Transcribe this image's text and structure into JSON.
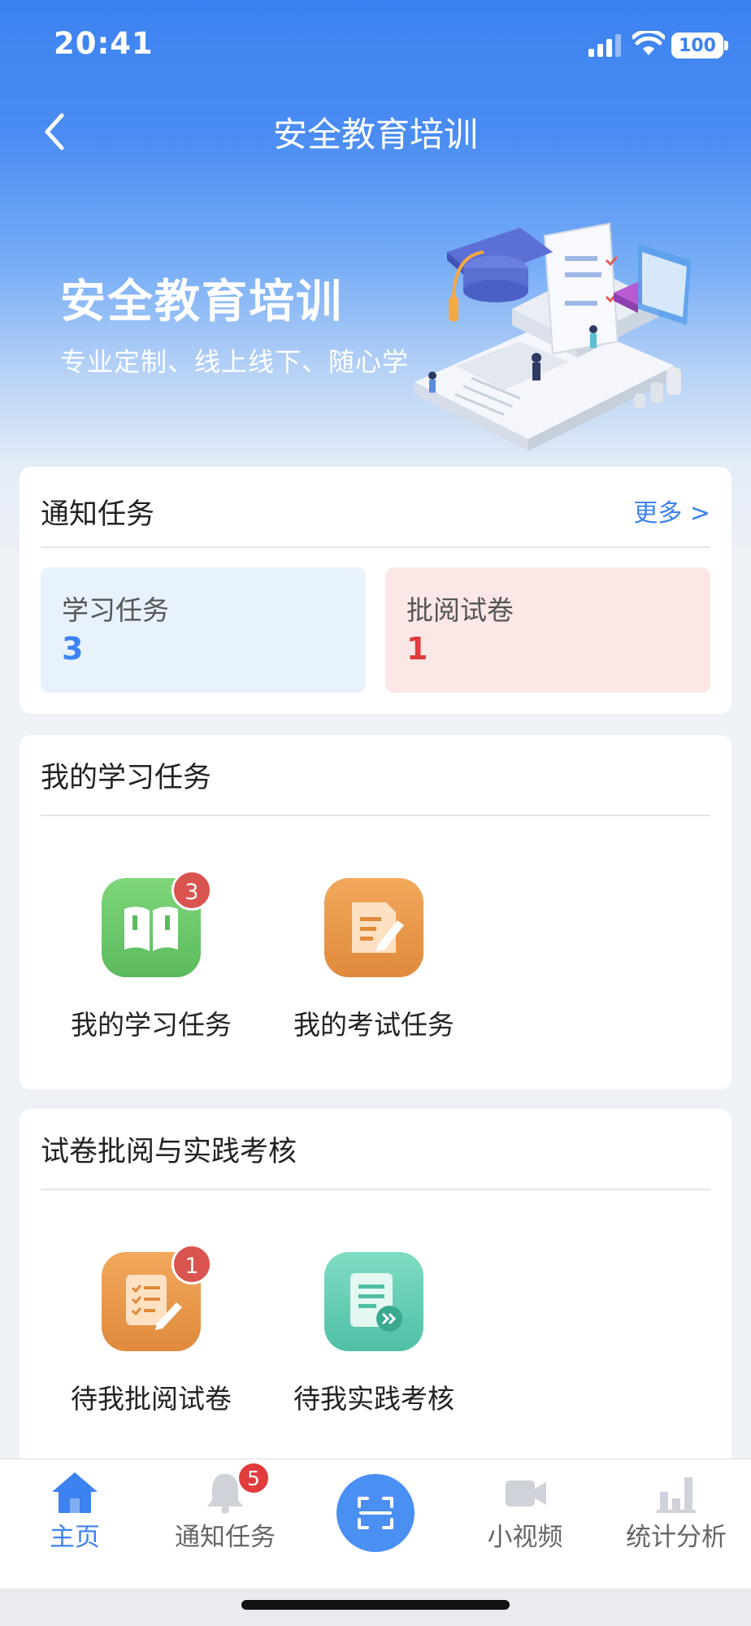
{
  "status_bar": {
    "time": "20:41",
    "battery": "100"
  },
  "nav": {
    "title": "安全教育培训"
  },
  "hero": {
    "title": "安全教育培训",
    "subtitle": "专业定制、线上线下、随心学"
  },
  "notice_card": {
    "title": "通知任务",
    "more": "更多 >",
    "items": [
      {
        "label": "学习任务",
        "count": "3",
        "color": "#3c82f0"
      },
      {
        "label": "批阅试卷",
        "count": "1",
        "color": "#e03c3c"
      }
    ]
  },
  "study_card": {
    "title": "我的学习任务",
    "items": [
      {
        "label": "我的学习任务",
        "badge": "3",
        "icon": "book-icon"
      },
      {
        "label": "我的考试任务",
        "badge": "",
        "icon": "exam-edit-icon"
      }
    ]
  },
  "review_card": {
    "title": "试卷批阅与实践考核",
    "items": [
      {
        "label": "待我批阅试卷",
        "badge": "1",
        "icon": "checklist-icon"
      },
      {
        "label": "待我实践考核",
        "badge": "",
        "icon": "document-forward-icon"
      }
    ]
  },
  "tab_bar": {
    "items": [
      {
        "label": "主页",
        "icon": "home-icon",
        "active": true
      },
      {
        "label": "通知任务",
        "icon": "bell-icon",
        "badge": "5"
      },
      {
        "label": "",
        "icon": "scan-icon"
      },
      {
        "label": "小视频",
        "icon": "video-icon"
      },
      {
        "label": "统计分析",
        "icon": "bar-chart-icon"
      }
    ]
  },
  "colors": {
    "primary": "#3c82f0",
    "danger": "#e03c3c",
    "badge": "#d9534f",
    "blue_tint": "#e8f2fd",
    "red_tint": "#fbe7e6"
  }
}
